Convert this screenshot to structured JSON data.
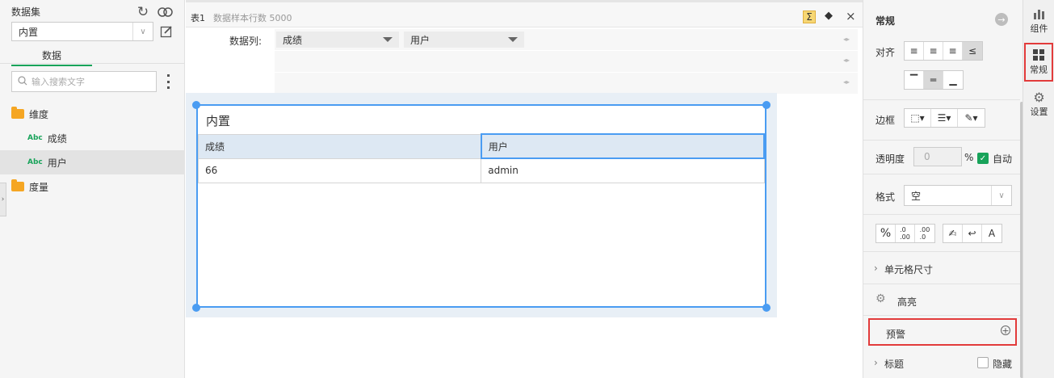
{
  "left": {
    "dataset_title": "数据集",
    "dataset_select": "内置",
    "tab_data": "数据",
    "search_placeholder": "输入搜索文字",
    "tree": [
      {
        "label": "维度",
        "type": "folder"
      },
      {
        "label": "成绩",
        "type": "field",
        "badge": "Abc"
      },
      {
        "label": "用户",
        "type": "field",
        "badge": "Abc"
      },
      {
        "label": "度量",
        "type": "folder"
      }
    ]
  },
  "center": {
    "tab_name": "表1",
    "sample_rows": "数据样本行数 5000",
    "field_label": "数据列:",
    "fields": [
      "成绩",
      "用户"
    ],
    "widget_title": "内置",
    "table": {
      "headers": [
        "成绩",
        "用户"
      ],
      "rows": [
        [
          "66",
          "admin"
        ]
      ]
    }
  },
  "right": {
    "title": "常规",
    "align_label": "对齐",
    "border_label": "边框",
    "opacity_label": "透明度",
    "opacity_value": "0",
    "percent": "%",
    "auto_label": "自动",
    "format_label": "格式",
    "format_value": "空",
    "cell_size_label": "单元格尺寸",
    "highlight_label": "高亮",
    "warning_label": "预警",
    "title_label": "标题",
    "hide_label": "隐藏"
  },
  "sidebar_tabs": [
    {
      "label": "组件",
      "icon": "bar-chart-icon"
    },
    {
      "label": "常规",
      "icon": "grid-icon"
    },
    {
      "label": "设置",
      "icon": "gear-icon"
    }
  ],
  "colors": {
    "accent": "#18a35a",
    "selection": "#4a9cf2",
    "highlight_box": "#e23b3b"
  }
}
